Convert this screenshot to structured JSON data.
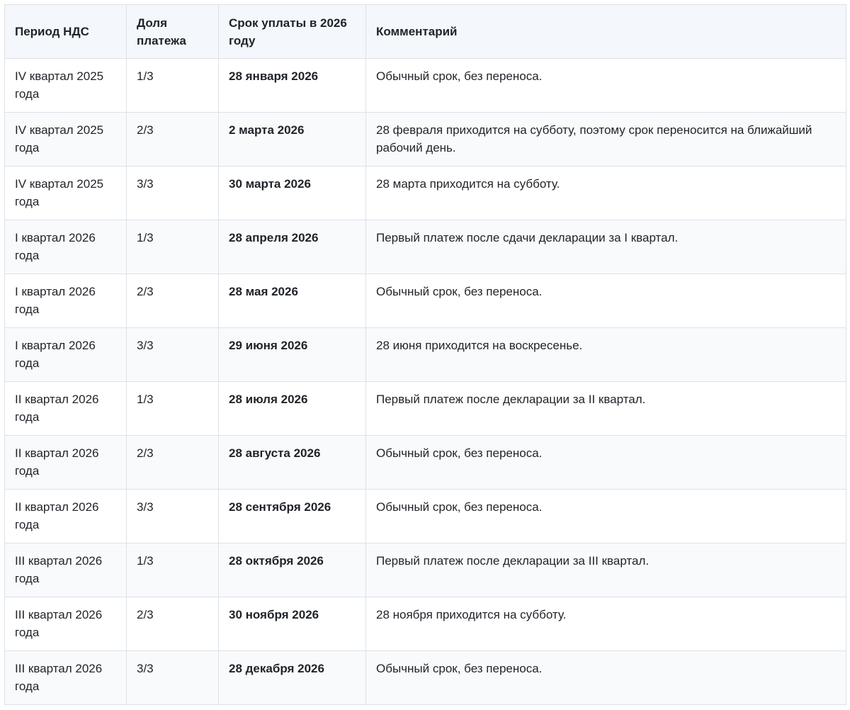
{
  "table": {
    "headers": [
      "Период НДС",
      "Доля платежа",
      "Срок уплаты в 2026 году",
      "Комментарий"
    ],
    "rows": [
      {
        "period": "IV квартал 2025 года",
        "share": "1/3",
        "due": "28 января 2026",
        "comment": "Обычный срок, без переноса."
      },
      {
        "period": "IV квартал 2025 года",
        "share": "2/3",
        "due": "2 марта 2026",
        "comment": "28 февраля приходится на субботу, поэтому срок переносится на ближайший рабочий день."
      },
      {
        "period": "IV квартал 2025 года",
        "share": "3/3",
        "due": "30 марта 2026",
        "comment": "28 марта приходится на субботу."
      },
      {
        "period": "I квартал 2026 года",
        "share": "1/3",
        "due": "28 апреля 2026",
        "comment": "Первый платеж после сдачи декларации за I квартал."
      },
      {
        "period": "I квартал 2026 года",
        "share": "2/3",
        "due": "28 мая 2026",
        "comment": "Обычный срок, без переноса."
      },
      {
        "period": "I квартал 2026 года",
        "share": "3/3",
        "due": "29 июня 2026",
        "comment": "28 июня приходится на воскресенье."
      },
      {
        "period": "II квартал 2026 года",
        "share": "1/3",
        "due": "28 июля 2026",
        "comment": "Первый платеж после декларации за II квартал."
      },
      {
        "period": "II квартал 2026 года",
        "share": "2/3",
        "due": "28 августа 2026",
        "comment": "Обычный срок, без переноса."
      },
      {
        "period": "II квартал 2026 года",
        "share": "3/3",
        "due": "28 сентября 2026",
        "comment": "Обычный срок, без переноса."
      },
      {
        "period": "III квартал 2026 года",
        "share": "1/3",
        "due": "28 октября 2026",
        "comment": "Первый платеж после декларации за III квартал."
      },
      {
        "period": "III квартал 2026 года",
        "share": "2/3",
        "due": "30 ноября 2026",
        "comment": "28 ноября приходится на субботу."
      },
      {
        "period": "III квартал 2026 года",
        "share": "3/3",
        "due": "28 декабря 2026",
        "comment": "Обычный срок, без переноса."
      }
    ]
  }
}
